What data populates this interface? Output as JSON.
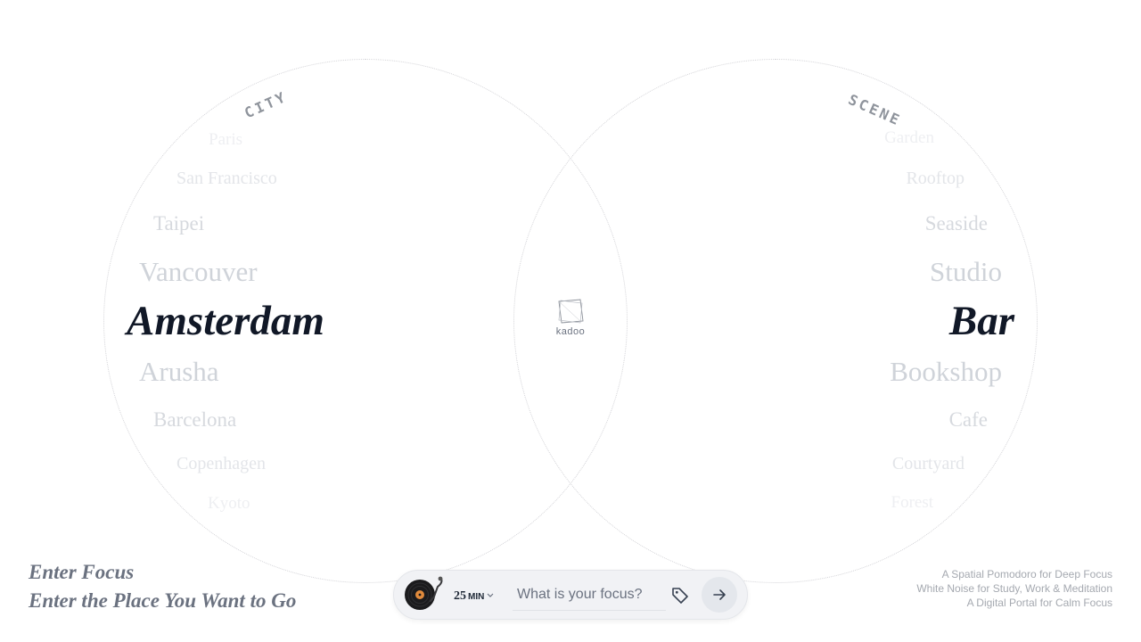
{
  "city_wheel": {
    "label": "CITY",
    "items": [
      {
        "label": "Paris"
      },
      {
        "label": "San Francisco"
      },
      {
        "label": "Taipei"
      },
      {
        "label": "Vancouver"
      },
      {
        "label": "Amsterdam"
      },
      {
        "label": "Arusha"
      },
      {
        "label": "Barcelona"
      },
      {
        "label": "Copenhagen"
      },
      {
        "label": "Kyoto"
      }
    ],
    "selected": "Amsterdam"
  },
  "scene_wheel": {
    "label": "SCENE",
    "items": [
      {
        "label": "Garden"
      },
      {
        "label": "Rooftop"
      },
      {
        "label": "Seaside"
      },
      {
        "label": "Studio"
      },
      {
        "label": "Bar"
      },
      {
        "label": "Bookshop"
      },
      {
        "label": "Cafe"
      },
      {
        "label": "Courtyard"
      },
      {
        "label": "Forest"
      }
    ],
    "selected": "Bar"
  },
  "logo": {
    "text": "kadoo",
    "icon": "kadoo-logo-icon"
  },
  "taglines": [
    "Enter Focus",
    "Enter the Place You Want to Go"
  ],
  "descriptions": [
    "A Spatial Pomodoro for Deep Focus",
    "White Noise for Study, Work & Meditation",
    "A Digital Portal for Calm Focus"
  ],
  "focus_bar": {
    "vinyl_icon": "vinyl-record-icon",
    "duration_value": "25",
    "duration_unit": "MIN",
    "input_placeholder": "What is your focus?",
    "input_value": "",
    "tag_icon": "tag-icon",
    "submit_icon": "arrow-right-icon"
  },
  "colors": {
    "selected_text": "#111827",
    "faded_text": "#d6d9de",
    "tagline_text": "#6b7280",
    "bar_background": "#f1f2f5"
  }
}
